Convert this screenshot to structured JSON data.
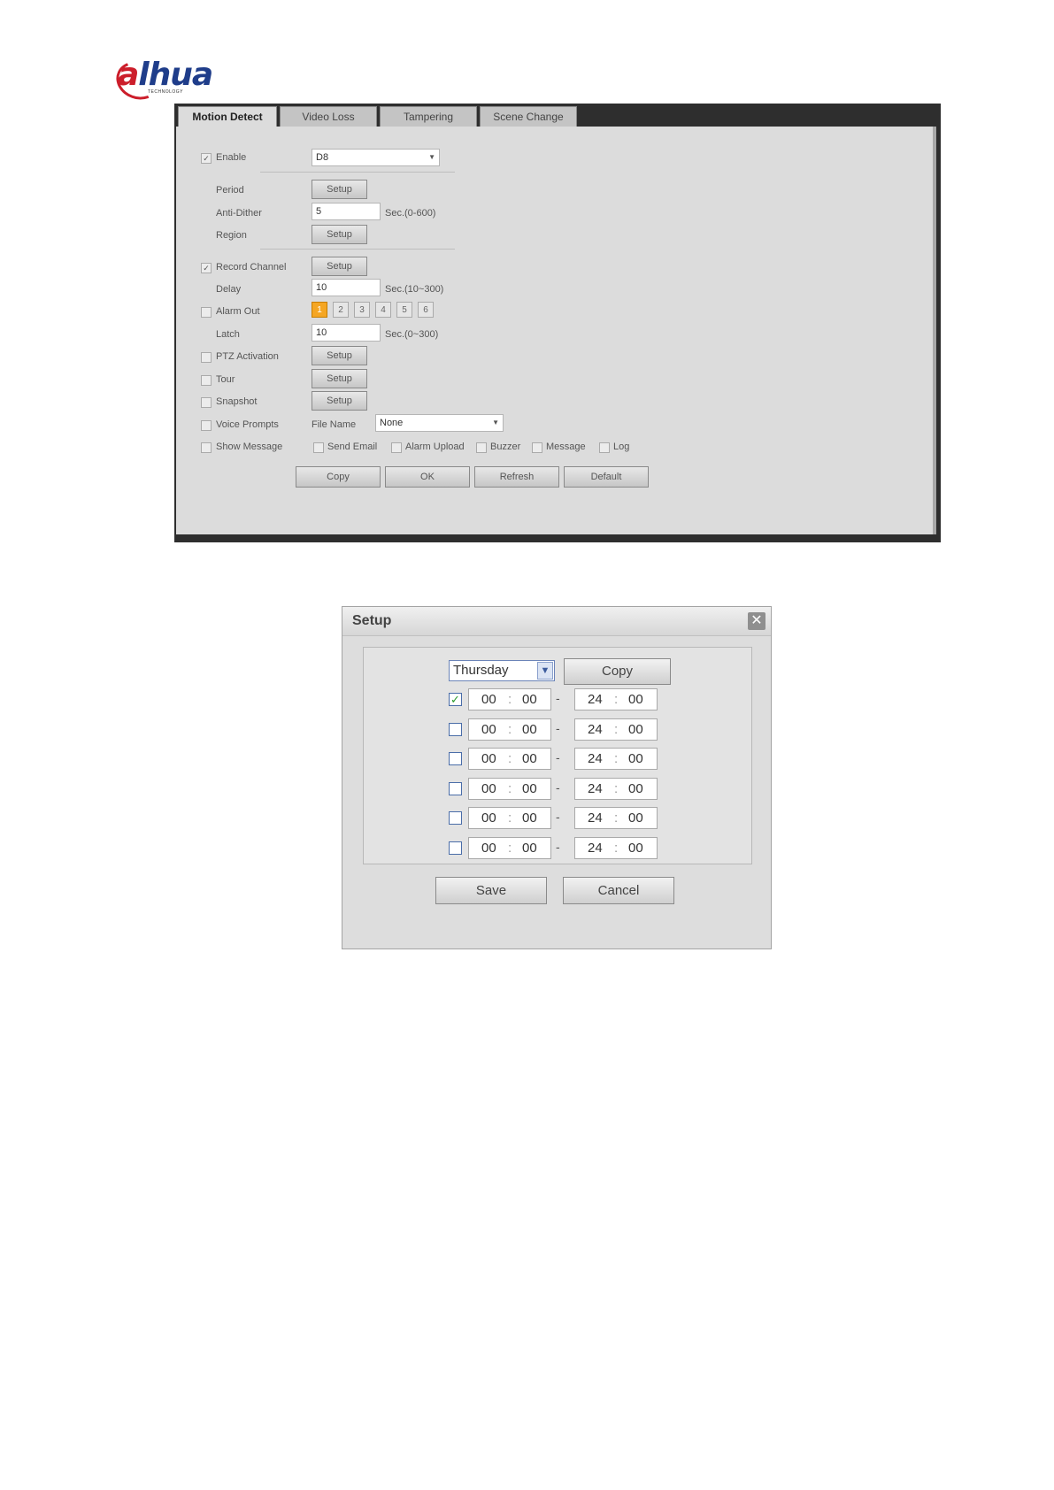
{
  "logo": {
    "brand_prefix": "a",
    "brand_rest": "lhua",
    "subtitle": "TECHNOLOGY"
  },
  "tabs": [
    "Motion Detect",
    "Video Loss",
    "Tampering",
    "Scene Change"
  ],
  "motion": {
    "enable_label": "Enable",
    "enable_checked": "✓",
    "channel_value": "D8",
    "period_label": "Period",
    "anti_dither_label": "Anti-Dither",
    "anti_dither_value": "5",
    "anti_dither_unit": "Sec.(0-600)",
    "region_label": "Region",
    "record_channel_label": "Record Channel",
    "record_checked": "✓",
    "delay_label": "Delay",
    "delay_value": "10",
    "delay_unit": "Sec.(10~300)",
    "alarm_out_label": "Alarm Out",
    "alarm_outputs": [
      "1",
      "2",
      "3",
      "4",
      "5",
      "6"
    ],
    "latch_label": "Latch",
    "latch_value": "10",
    "latch_unit": "Sec.(0~300)",
    "ptz_label": "PTZ Activation",
    "tour_label": "Tour",
    "snapshot_label": "Snapshot",
    "voice_label": "Voice Prompts",
    "file_name_label": "File Name",
    "file_name_value": "None",
    "show_message_label": "Show Message",
    "send_email_label": "Send Email",
    "alarm_upload_label": "Alarm Upload",
    "buzzer_label": "Buzzer",
    "message_label": "Message",
    "log_label": "Log",
    "setup_label": "Setup",
    "copy_label": "Copy",
    "ok_label": "OK",
    "refresh_label": "Refresh",
    "default_label": "Default"
  },
  "dialog": {
    "title": "Setup",
    "close_glyph": "✕",
    "day": "Thursday",
    "copy_label": "Copy",
    "checked_glyph": "✓",
    "periods": [
      {
        "checked": true,
        "start_h": "00",
        "start_m": "00",
        "end_h": "24",
        "end_m": "00"
      },
      {
        "checked": false,
        "start_h": "00",
        "start_m": "00",
        "end_h": "24",
        "end_m": "00"
      },
      {
        "checked": false,
        "start_h": "00",
        "start_m": "00",
        "end_h": "24",
        "end_m": "00"
      },
      {
        "checked": false,
        "start_h": "00",
        "start_m": "00",
        "end_h": "24",
        "end_m": "00"
      },
      {
        "checked": false,
        "start_h": "00",
        "start_m": "00",
        "end_h": "24",
        "end_m": "00"
      },
      {
        "checked": false,
        "start_h": "00",
        "start_m": "00",
        "end_h": "24",
        "end_m": "00"
      }
    ],
    "save_label": "Save",
    "cancel_label": "Cancel"
  }
}
